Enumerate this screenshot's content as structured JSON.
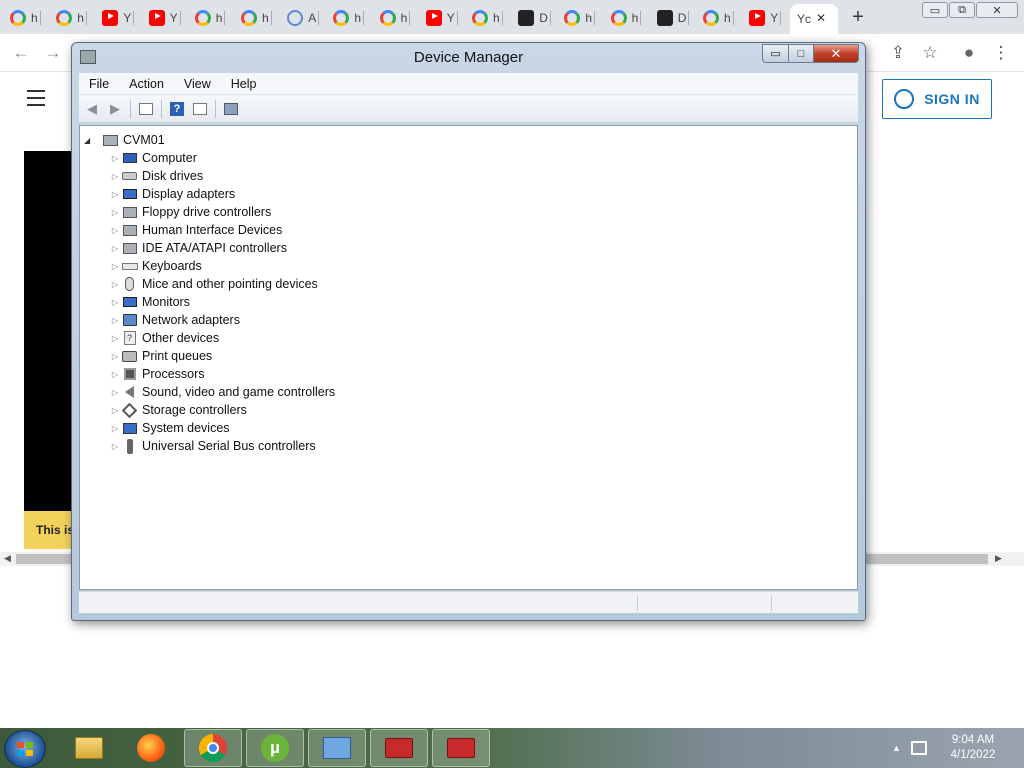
{
  "browser": {
    "tabs": [
      {
        "icon": "google-icon",
        "label": "h"
      },
      {
        "icon": "google-icon",
        "label": "h"
      },
      {
        "icon": "youtube-icon",
        "label": "Y"
      },
      {
        "icon": "youtube-icon",
        "label": "Y"
      },
      {
        "icon": "google-icon",
        "label": "h"
      },
      {
        "icon": "google-icon",
        "label": "h"
      },
      {
        "icon": "globe-icon",
        "label": "A"
      },
      {
        "icon": "google-icon",
        "label": "h"
      },
      {
        "icon": "google-icon",
        "label": "h"
      },
      {
        "icon": "youtube-icon",
        "label": "Y"
      },
      {
        "icon": "google-icon",
        "label": "h"
      },
      {
        "icon": "bot-icon",
        "label": "D"
      },
      {
        "icon": "google-icon",
        "label": "h"
      },
      {
        "icon": "google-icon",
        "label": "h"
      },
      {
        "icon": "bot-icon",
        "label": "D"
      },
      {
        "icon": "google-icon",
        "label": "h"
      },
      {
        "icon": "youtube-icon",
        "label": "Y"
      }
    ],
    "active_tab": {
      "label": "Yc",
      "close": "✕"
    },
    "new_tab": "+",
    "window_controls": {
      "minimize": "▭",
      "restore": "⧉",
      "close": "✕"
    },
    "toolbar": {
      "back": "←",
      "forward": "→",
      "share": "⇪",
      "star": "☆",
      "account": "●",
      "menu": "⋮"
    },
    "page": {
      "sign_in_label": "SIGN IN",
      "banner_text": "This is"
    }
  },
  "device_manager": {
    "title": "Device Manager",
    "controls": {
      "minimize": "▭",
      "maximize": "□",
      "close": "✕"
    },
    "menu": [
      "File",
      "Action",
      "View",
      "Help"
    ],
    "toolbar": {
      "back": "◀",
      "forward": "▶",
      "help": "?"
    },
    "tree": {
      "root": "CVM01",
      "items": [
        {
          "label": "Computer",
          "icon": "ic-comp"
        },
        {
          "label": "Disk drives",
          "icon": "ic-disk"
        },
        {
          "label": "Display adapters",
          "icon": "ic-mon"
        },
        {
          "label": "Floppy drive controllers",
          "icon": "ic-box"
        },
        {
          "label": "Human Interface Devices",
          "icon": "ic-box"
        },
        {
          "label": "IDE ATA/ATAPI controllers",
          "icon": "ic-box"
        },
        {
          "label": "Keyboards",
          "icon": "ic-kbd"
        },
        {
          "label": "Mice and other pointing devices",
          "icon": "ic-mouse"
        },
        {
          "label": "Monitors",
          "icon": "ic-mon"
        },
        {
          "label": "Network adapters",
          "icon": "ic-net"
        },
        {
          "label": "Other devices",
          "icon": "ic-other"
        },
        {
          "label": "Print queues",
          "icon": "ic-print"
        },
        {
          "label": "Processors",
          "icon": "ic-cpu"
        },
        {
          "label": "Sound, video and game controllers",
          "icon": "ic-sound"
        },
        {
          "label": "Storage controllers",
          "icon": "ic-store"
        },
        {
          "label": "System devices",
          "icon": "ic-sys"
        },
        {
          "label": "Universal Serial Bus controllers",
          "icon": "ic-usb"
        }
      ]
    }
  },
  "taskbar": {
    "apps": [
      "windows-explorer-icon",
      "firefox-icon",
      "chrome-icon",
      "utorrent-icon",
      "remote-desktop-icon",
      "toolbox-icon",
      "toolbox-icon"
    ],
    "utorrent_glyph": "µ",
    "tray": {
      "show_hidden": "▲"
    },
    "clock": {
      "time": "9:04 AM",
      "date": "4/1/2022"
    }
  }
}
